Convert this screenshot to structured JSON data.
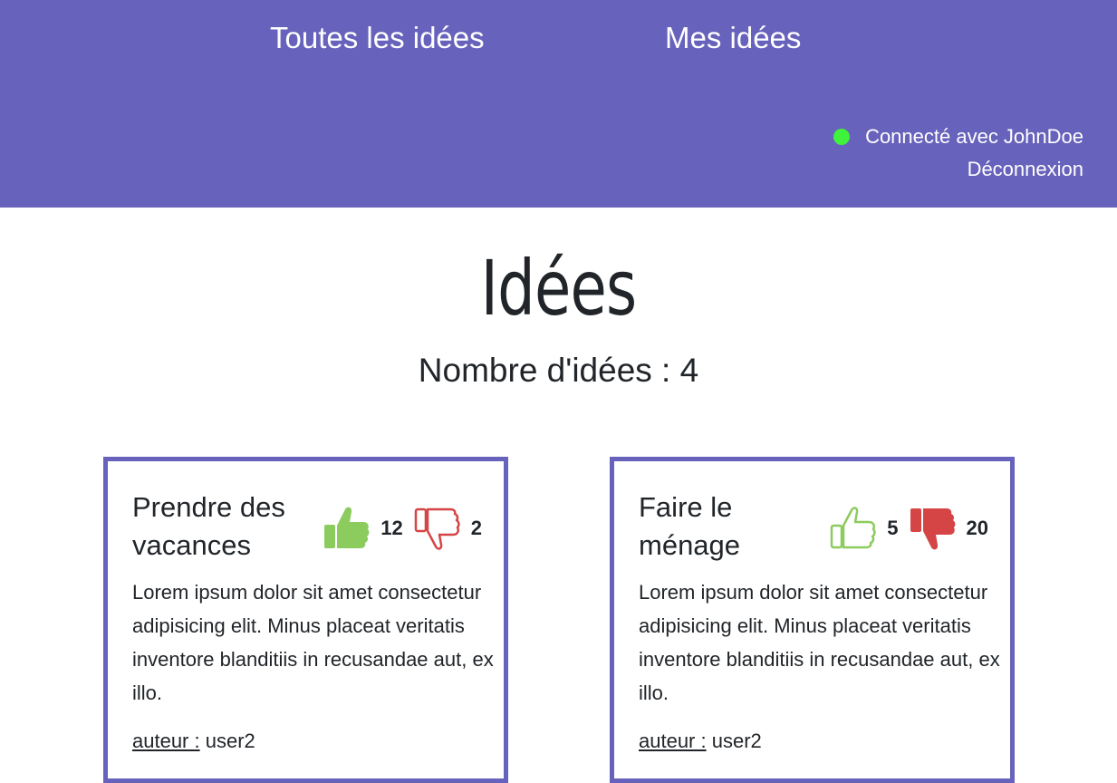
{
  "nav": {
    "all_ideas": "Toutes les idées",
    "my_ideas": "Mes idées"
  },
  "session": {
    "status_text": "Connecté avec JohnDoe",
    "status_color": "#3ff23b",
    "logout": "Déconnexion"
  },
  "page": {
    "title": "Idées",
    "count_text": "Nombre d'idées : 4"
  },
  "theme": {
    "primary": "#6762bb",
    "like_green": "#8ccb5e",
    "dislike_red": "#d64545"
  },
  "ideas": [
    {
      "title": "Prendre des vacances",
      "likes": "12",
      "dislikes": "2",
      "like_icon": "thumbs-up-filled-icon",
      "dislike_icon": "thumbs-down-outline-icon",
      "description": "Lorem ipsum dolor sit amet consectetur adipisicing elit. Minus placeat veritatis inventore blanditiis in recusandae aut, ex illo.",
      "author_label": "auteur :",
      "author": "user2"
    },
    {
      "title": "Faire le ménage",
      "likes": "5",
      "dislikes": "20",
      "like_icon": "thumbs-up-outline-icon",
      "dislike_icon": "thumbs-down-filled-icon",
      "description": "Lorem ipsum dolor sit amet consectetur adipisicing elit. Minus placeat veritatis inventore blanditiis in recusandae aut, ex illo.",
      "author_label": "auteur :",
      "author": "user2"
    }
  ]
}
